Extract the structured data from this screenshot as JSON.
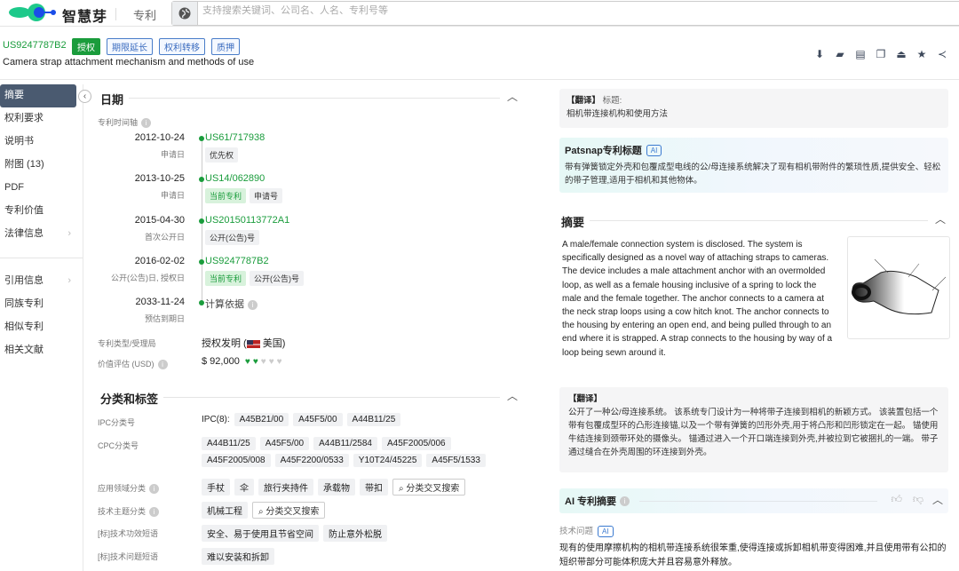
{
  "topbar": {
    "brand": "智慧芽",
    "nav": "专利",
    "search_placeholder": "支持搜索关键词、公司名、人名、专利号等"
  },
  "header": {
    "patent_number": "US9247787B2",
    "status": "授权",
    "tags": [
      "期限延长",
      "权利转移",
      "质押"
    ],
    "title": "Camera strap attachment mechanism and methods of use",
    "actions": [
      "pdf-download-icon",
      "folder-icon",
      "document-icon",
      "copy-icon",
      "export-icon",
      "star-icon",
      "share-icon"
    ]
  },
  "sidebar": {
    "items": [
      "摘要",
      "权利要求",
      "说明书",
      "附图 (13)",
      "PDF",
      "专利价值",
      "法律信息"
    ],
    "items2": [
      "引用信息",
      "同族专利",
      "相似专利",
      "相关文献"
    ]
  },
  "dates": {
    "title": "日期",
    "timeline_label": "专利时间轴",
    "events": [
      {
        "date": "2012-10-24",
        "kind": "申请日",
        "number": "US61/717938",
        "chips": [
          "优先权"
        ],
        "current": false
      },
      {
        "date": "2013-10-25",
        "kind": "申请日",
        "number": "US14/062890",
        "chips": [
          "当前专利",
          "申请号"
        ],
        "current": true
      },
      {
        "date": "2015-04-30",
        "kind": "首次公开日",
        "number": "US20150113772A1",
        "chips": [
          "公开(公告)号"
        ],
        "current": false
      },
      {
        "date": "2016-02-02",
        "kind": "公开(公告)日, 授权日",
        "number": "US9247787B2",
        "chips": [
          "当前专利",
          "公开(公告)号"
        ],
        "current": true
      },
      {
        "date": "2033-11-24",
        "kind": "预估到期日",
        "number": "计算依据",
        "chips": [],
        "current": false
      }
    ],
    "type_label": "专利类型/受理局",
    "type_value": "授权发明 (",
    "country": "美国)",
    "value_label": "价值评估 (USD)",
    "value": "$ 92,000",
    "value_rating": 2,
    "value_max": 5
  },
  "classification": {
    "title": "分类和标签",
    "ipc_label": "IPC分类号",
    "ipc_prefix": "IPC(8):",
    "ipc": [
      "A45B21/00",
      "A45F5/00",
      "A44B11/25"
    ],
    "cpc_label": "CPC分类号",
    "cpc": [
      "A44B11/25",
      "A45F5/00",
      "A44B11/2584",
      "A45F2005/006",
      "A45F2005/008",
      "A45F2200/0533",
      "Y10T24/45225",
      "A45F5/1533"
    ],
    "app_label": "应用领域分类",
    "app": [
      "手杖",
      "伞",
      "旅行夹持件",
      "承载物",
      "带扣"
    ],
    "topic_label": "技术主题分类",
    "topic": [
      "机械工程"
    ],
    "cross_search": "分类交叉搜索",
    "effect_label": "[标]技术功效短语",
    "effect": [
      "安全、易于使用且节省空间",
      "防止意外松脱"
    ],
    "problem_label": "[标]技术问题短语",
    "problem": [
      "难以安装和拆卸"
    ]
  },
  "right": {
    "trans_title_tag": "【翻译】",
    "trans_title_label": "标题:",
    "trans_title": "相机带连接机构和使用方法",
    "ai_title_head": "Patsnap专利标题",
    "ai_badge": "AI",
    "ai_title": "带有弹簧锁定外壳和包覆成型电线的公/母连接系统解决了现有相机带附件的繁琐性质,提供安全、轻松的带子管理,适用于相机和其他物体。",
    "abstract_head": "摘要",
    "abstract": "A male/female connection system is disclosed. The system is specifically designed as a novel way of attaching straps to cameras. The device includes a male attachment anchor with an overmolded loop, as well as a female housing inclusive of a spring to lock the male and the female together. The anchor connects to a camera at the neck strap loops using a cow hitch knot. The anchor connects to the housing by entering an open end, and being pulled through to an end where it is strapped. A strap connects to the housing by way of a loop being sewn around it.",
    "trans_abs_tag": "【翻译】",
    "trans_abs": "公开了一种公/母连接系统。 该系统专门设计为一种将带子连接到相机的新颖方式。 该装置包括一个带有包覆成型环的凸形连接锚,以及一个带有弹簧的凹形外壳,用于将凸形和凹形锁定在一起。 锚使用牛结连接到颈带环处的摄像头。 锚通过进入一个开口端连接到外壳,并被拉到它被捆扎的一端。 带子通过缝合在外壳周围的环连接到外壳。",
    "ai_abs_head": "AI 专利摘要",
    "tech_problem_label": "技术问题",
    "tech_problem": "现有的使用摩擦机构的相机带连接系统很笨重,使得连接或拆卸相机带变得困难,并且使用带有公扣的短织带部分可能体积庞大并且容易意外释放。"
  },
  "colors": {
    "green": "#1a9c3c",
    "blue": "#3b6cbf",
    "sidebar_active": "#4a5a70"
  }
}
